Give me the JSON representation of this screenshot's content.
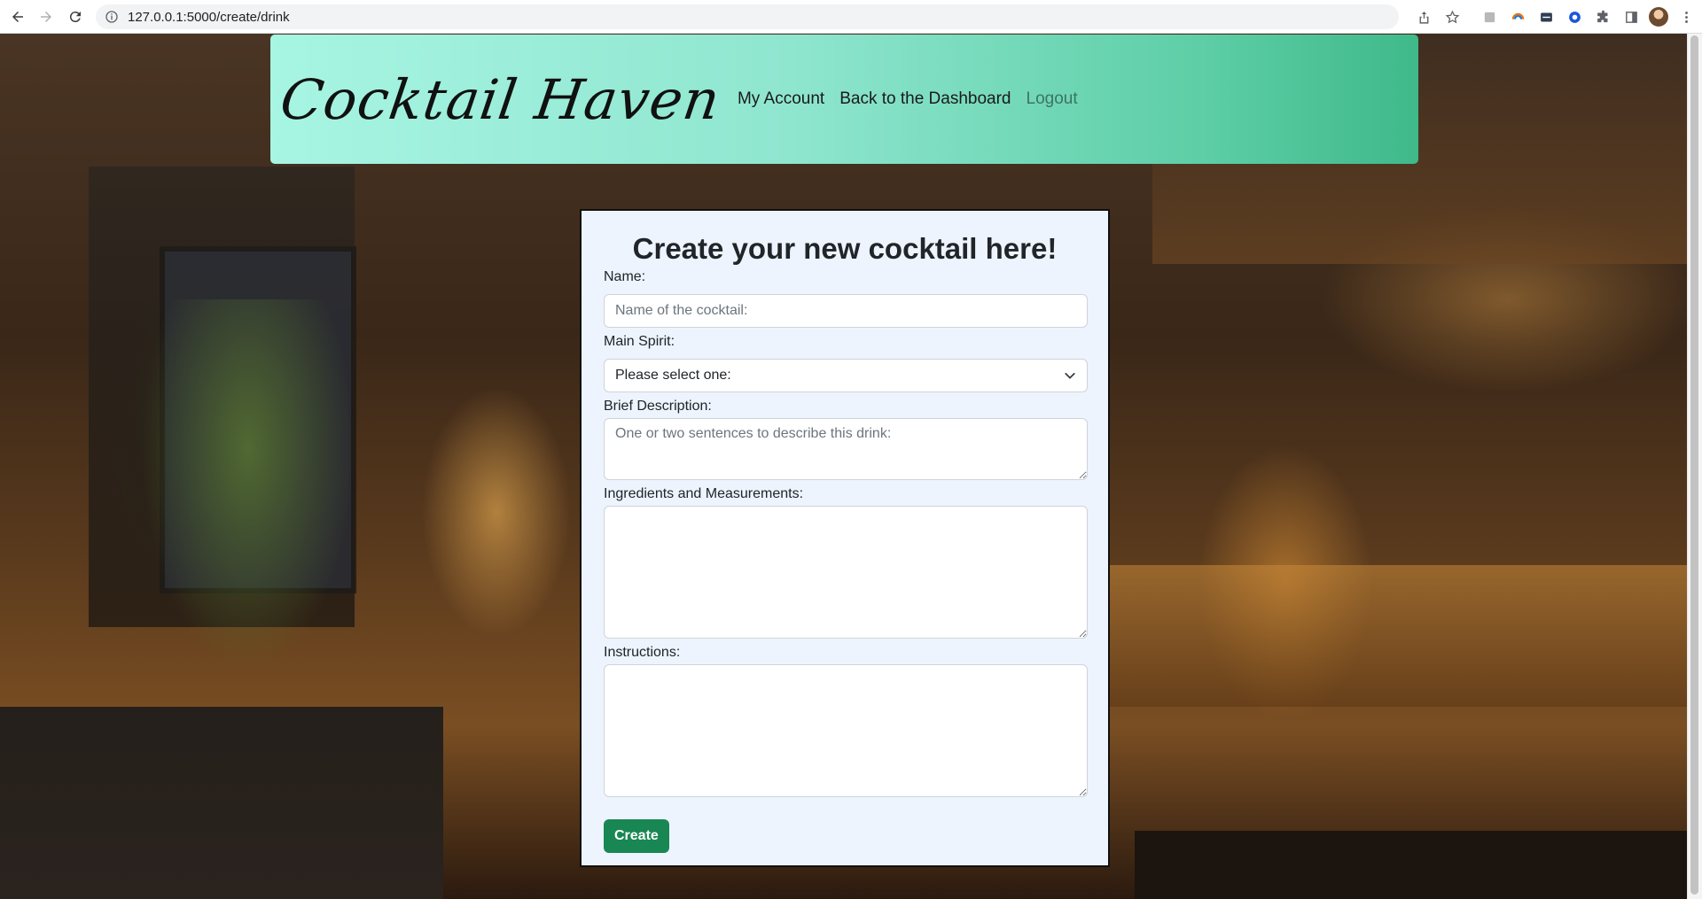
{
  "browser": {
    "url": "127.0.0.1:5000/create/drink"
  },
  "header": {
    "brand": "Cocktail Haven",
    "nav": {
      "account": "My Account",
      "dashboard": "Back to the Dashboard",
      "logout": "Logout"
    }
  },
  "form": {
    "title": "Create your new cocktail here!",
    "name_label": "Name:",
    "name_placeholder": "Name of the cocktail:",
    "spirit_label": "Main Spirit:",
    "spirit_selected": "Please select one:",
    "description_label": "Brief Description:",
    "description_placeholder": "One or two sentences to describe this drink:",
    "ingredients_label": "Ingredients and Measurements:",
    "instructions_label": "Instructions:",
    "submit_label": "Create"
  },
  "colors": {
    "header_gradient_start": "#a7f5e3",
    "header_gradient_end": "#3fb98a",
    "card_background": "#edf4fd",
    "button": "#198754"
  }
}
